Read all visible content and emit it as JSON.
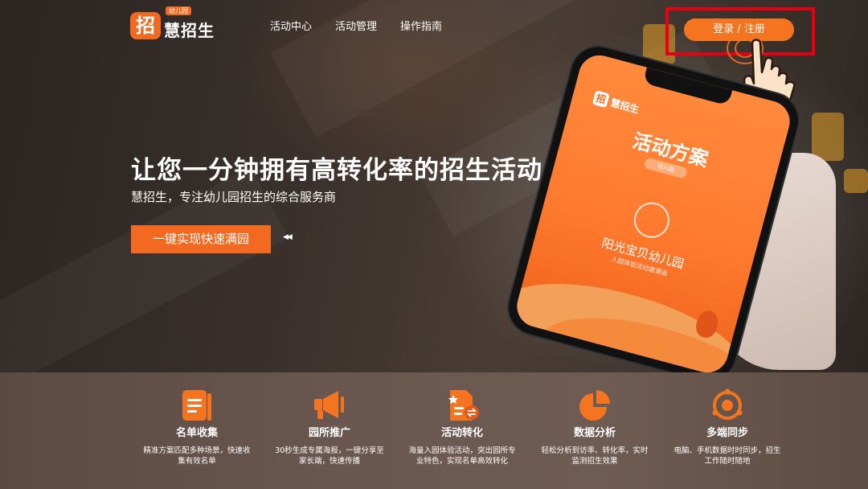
{
  "brand": {
    "mark": "招",
    "tag": "幼儿园",
    "name": "慧招生"
  },
  "nav": {
    "items": [
      "活动中心",
      "活动管理",
      "操作指南"
    ]
  },
  "header": {
    "login_label": "登录 / 注册"
  },
  "hero": {
    "headline": "让您一分钟拥有高转化率的招生活动",
    "subline": "慧招生，专注幼儿园招生的综合服务商",
    "cta_label": "一键实现快速满园",
    "carousel_arrows": "◀◀"
  },
  "phone_screen": {
    "logo_mark": "招",
    "logo_text": "慧招生",
    "title": "活动方案",
    "pill": "幼儿园",
    "school_name": "阳光宝贝幼儿园",
    "school_sub": "入园体验活动邀请函"
  },
  "features": [
    {
      "title": "名单收集",
      "desc": "精准方案匹配多种场景，快速收集有效名单",
      "icon": "clipboard-list-icon"
    },
    {
      "title": "园所推广",
      "desc": "30秒生成专属海报，一键分享至家长端，快速传播",
      "icon": "megaphone-icon"
    },
    {
      "title": "活动转化",
      "desc": "海量入园体验活动，突出园所专业特色，实现名单高效转化",
      "icon": "document-exchange-icon"
    },
    {
      "title": "数据分析",
      "desc": "轻松分析到访率、转化率，实时监测招生效果",
      "icon": "pie-chart-icon"
    },
    {
      "title": "多端同步",
      "desc": "电脑、手机数据时时同步，招生工作随时随地",
      "icon": "sync-orbit-icon"
    }
  ],
  "colors": {
    "accent": "#f26a21",
    "highlight_border": "#e60012",
    "band": "#6a5850"
  }
}
